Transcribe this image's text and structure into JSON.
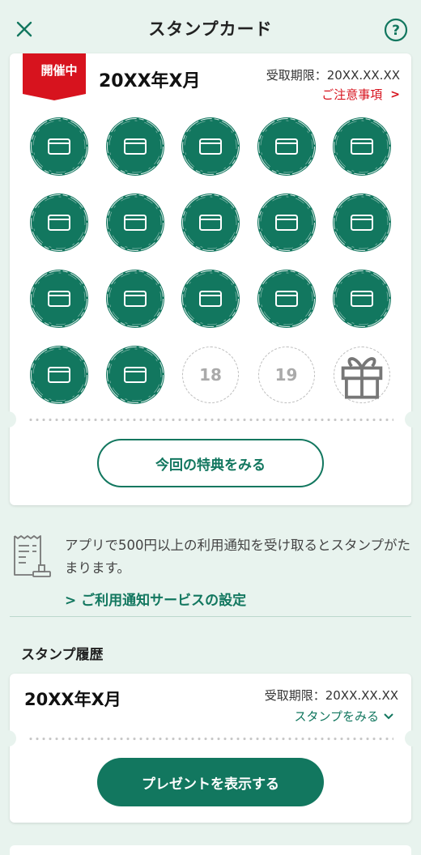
{
  "header": {
    "title": "スタンプカード"
  },
  "card": {
    "ribbon": "開催中",
    "period": "20XX年X月",
    "deadline": "受取期限：20XX.XX.XX",
    "notice": "ご注意事項",
    "stamps_collected": 17,
    "empty_slots": [
      "18",
      "19"
    ],
    "reward_icon": "gift-icon",
    "benefit_button": "今回の特典をみる"
  },
  "info": {
    "text": "アプリで500円以上の利用通知を受け取るとスタンプがたまります。",
    "link": "ご利用通知サービスの設定"
  },
  "history": {
    "title": "スタンプ履歴",
    "period": "20XX年X月",
    "deadline": "受取期限：20XX.XX.XX",
    "view_link": "スタンプをみる",
    "present_button": "プレゼントを表示する"
  },
  "colors": {
    "brand_green": "#12775f",
    "alert_red": "#d7131e",
    "background": "#e8f3ee"
  }
}
